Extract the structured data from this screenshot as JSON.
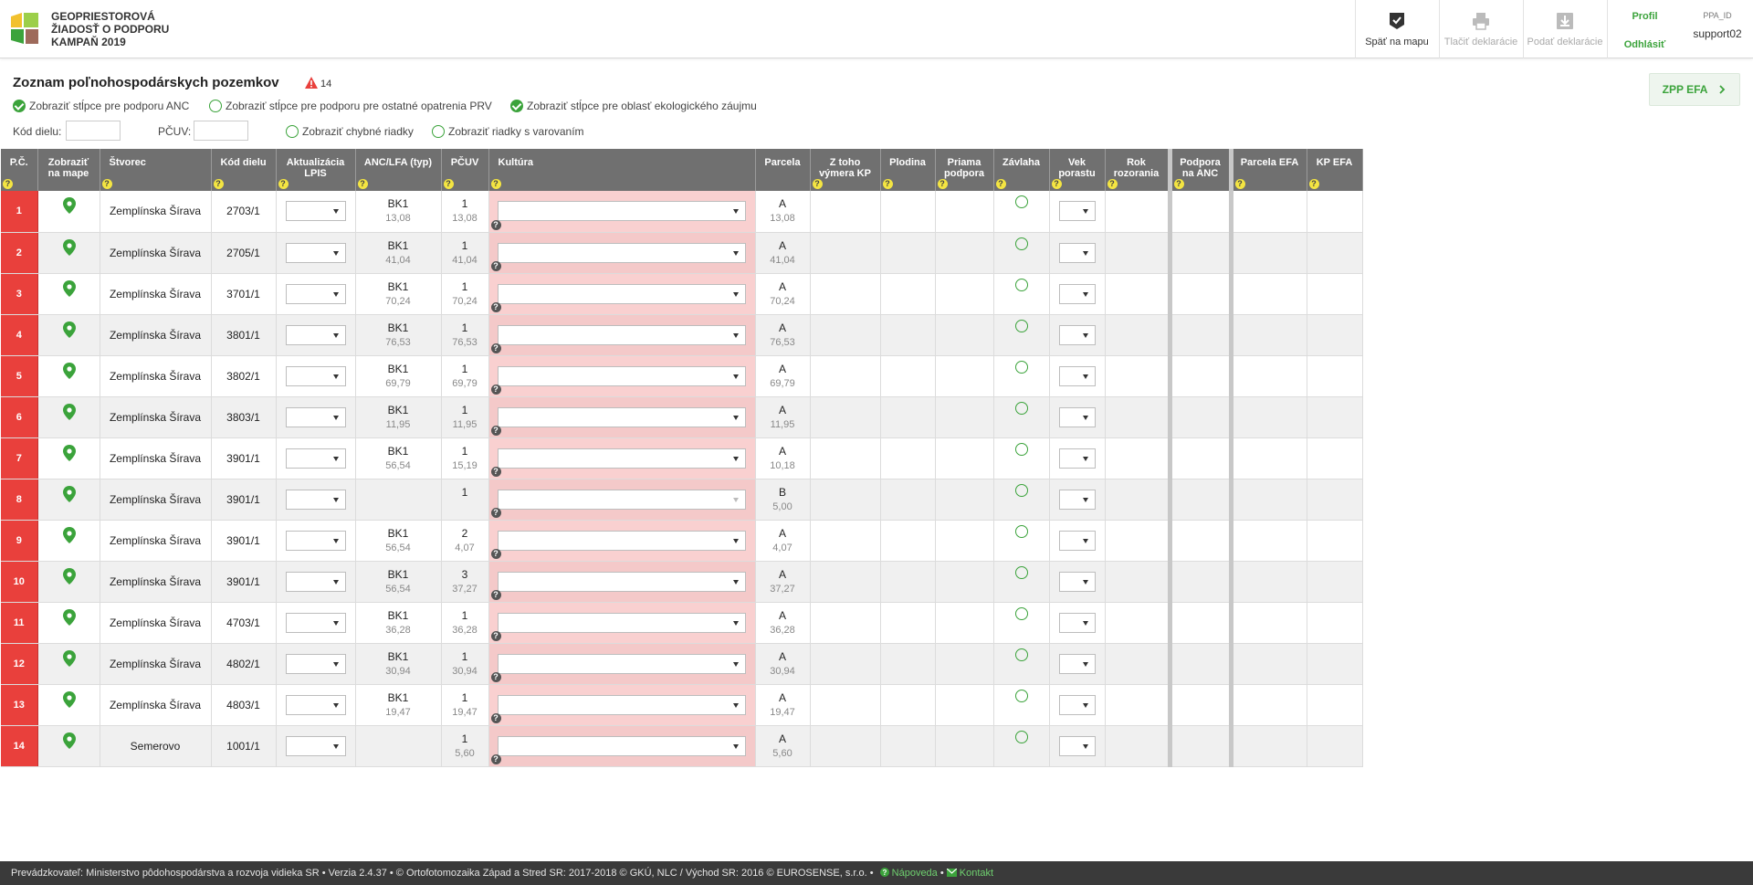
{
  "header": {
    "brand_line1": "GEOPRIESTOROVÁ",
    "brand_line2": "ŽIADOSŤ O PODPORU",
    "brand_line3": "KAMPAŇ 2019",
    "back_to_map": "Späť na mapu",
    "print": "Tlačiť deklarácie",
    "submit": "Podať deklarácie",
    "profile": "Profil",
    "logout": "Odhlásiť",
    "user_label": "PPA_ID",
    "user_name": "support02",
    "colors": {
      "accent": "#3ba33b",
      "danger": "#e9403c",
      "header_bg": "#707070"
    }
  },
  "page": {
    "title": "Zoznam poľnohospodárskych pozemkov",
    "warning_count": "14",
    "zpp_button": "ZPP EFA",
    "toggles": [
      {
        "label": "Zobraziť stĺpce pre podporu ANC",
        "checked": true
      },
      {
        "label": "Zobraziť stĺpce pre podporu pre ostatné opatrenia PRV",
        "checked": false
      },
      {
        "label": "Zobraziť stĺpce pre oblasť ekologického záujmu",
        "checked": true
      }
    ],
    "filter_kod_dielu": "Kód dielu:",
    "filter_pcuv": "PČUV:",
    "filter_errors": "Zobraziť chybné riadky",
    "filter_warnings": "Zobraziť riadky s varovaním"
  },
  "table": {
    "headers": {
      "pc": "P.Č.",
      "map_1": "Zobraziť",
      "map_2": "na mape",
      "stvorec": "Štvorec",
      "kod": "Kód dielu",
      "lpis_1": "Aktualizácia",
      "lpis_2": "LPIS",
      "anc": "ANC/LFA (typ)",
      "pcuv": "PČUV",
      "kultura": "Kultúra",
      "parcela": "Parcela",
      "ztoho_1": "Z toho",
      "ztoho_2": "výmera KP",
      "plodina": "Plodina",
      "priama_1": "Priama",
      "priama_2": "podpora",
      "zavlaha": "Závlaha",
      "vek_1": "Vek",
      "vek_2": "porastu",
      "rok_1": "Rok",
      "rok_2": "rozorania",
      "podpora_1": "Podpora",
      "podpora_2": "na ANC",
      "parcela_efa": "Parcela EFA",
      "kp_efa": "KP EFA",
      "help_mark": "?"
    },
    "rows": [
      {
        "pc": "1",
        "stvorec": "Zemplínska Šírava",
        "kod": "2703/1",
        "anc_typ": "BK1",
        "anc_val": "13,08",
        "pcuv": "1",
        "pcuv_val": "13,08",
        "parcela": "A",
        "parcela_val": "13,08"
      },
      {
        "pc": "2",
        "stvorec": "Zemplínska Šírava",
        "kod": "2705/1",
        "anc_typ": "BK1",
        "anc_val": "41,04",
        "pcuv": "1",
        "pcuv_val": "41,04",
        "parcela": "A",
        "parcela_val": "41,04"
      },
      {
        "pc": "3",
        "stvorec": "Zemplínska Šírava",
        "kod": "3701/1",
        "anc_typ": "BK1",
        "anc_val": "70,24",
        "pcuv": "1",
        "pcuv_val": "70,24",
        "parcela": "A",
        "parcela_val": "70,24"
      },
      {
        "pc": "4",
        "stvorec": "Zemplínska Šírava",
        "kod": "3801/1",
        "anc_typ": "BK1",
        "anc_val": "76,53",
        "pcuv": "1",
        "pcuv_val": "76,53",
        "parcela": "A",
        "parcela_val": "76,53"
      },
      {
        "pc": "5",
        "stvorec": "Zemplínska Šírava",
        "kod": "3802/1",
        "anc_typ": "BK1",
        "anc_val": "69,79",
        "pcuv": "1",
        "pcuv_val": "69,79",
        "parcela": "A",
        "parcela_val": "69,79"
      },
      {
        "pc": "6",
        "stvorec": "Zemplínska Šírava",
        "kod": "3803/1",
        "anc_typ": "BK1",
        "anc_val": "11,95",
        "pcuv": "1",
        "pcuv_val": "11,95",
        "parcela": "A",
        "parcela_val": "11,95"
      },
      {
        "pc": "7",
        "stvorec": "Zemplínska Šírava",
        "kod": "3901/1",
        "anc_typ": "BK1",
        "anc_val": "56,54",
        "pcuv": "1",
        "pcuv_val": "15,19",
        "parcela": "A",
        "parcela_val": "10,18"
      },
      {
        "pc": "8",
        "stvorec": "Zemplínska Šírava",
        "kod": "3901/1",
        "anc_typ": "",
        "anc_val": "",
        "pcuv": "1",
        "pcuv_val": "",
        "parcela": "B",
        "parcela_val": "5,00",
        "kultura_disabled": true
      },
      {
        "pc": "9",
        "stvorec": "Zemplínska Šírava",
        "kod": "3901/1",
        "anc_typ": "BK1",
        "anc_val": "56,54",
        "pcuv": "2",
        "pcuv_val": "4,07",
        "parcela": "A",
        "parcela_val": "4,07"
      },
      {
        "pc": "10",
        "stvorec": "Zemplínska Šírava",
        "kod": "3901/1",
        "anc_typ": "BK1",
        "anc_val": "56,54",
        "pcuv": "3",
        "pcuv_val": "37,27",
        "parcela": "A",
        "parcela_val": "37,27"
      },
      {
        "pc": "11",
        "stvorec": "Zemplínska Šírava",
        "kod": "4703/1",
        "anc_typ": "BK1",
        "anc_val": "36,28",
        "pcuv": "1",
        "pcuv_val": "36,28",
        "parcela": "A",
        "parcela_val": "36,28"
      },
      {
        "pc": "12",
        "stvorec": "Zemplínska Šírava",
        "kod": "4802/1",
        "anc_typ": "BK1",
        "anc_val": "30,94",
        "pcuv": "1",
        "pcuv_val": "30,94",
        "parcela": "A",
        "parcela_val": "30,94"
      },
      {
        "pc": "13",
        "stvorec": "Zemplínska Šírava",
        "kod": "4803/1",
        "anc_typ": "BK1",
        "anc_val": "19,47",
        "pcuv": "1",
        "pcuv_val": "19,47",
        "parcela": "A",
        "parcela_val": "19,47"
      },
      {
        "pc": "14",
        "stvorec": "Semerovo",
        "kod": "1001/1",
        "anc_typ": "",
        "anc_val": "",
        "pcuv": "1",
        "pcuv_val": "5,60",
        "parcela": "A",
        "parcela_val": "5,60"
      }
    ]
  },
  "footer": {
    "text": "Prevádzkovateľ: Ministerstvo pôdohospodárstva a rozvoja vidieka SR • Verzia 2.4.37 • © Ortofotomozaika Západ a Stred SR: 2017-2018 © GKÚ, NLC / Východ SR: 2016 © EUROSENSE, s.r.o. •",
    "help": "Nápoveda",
    "contact": "Kontakt"
  }
}
